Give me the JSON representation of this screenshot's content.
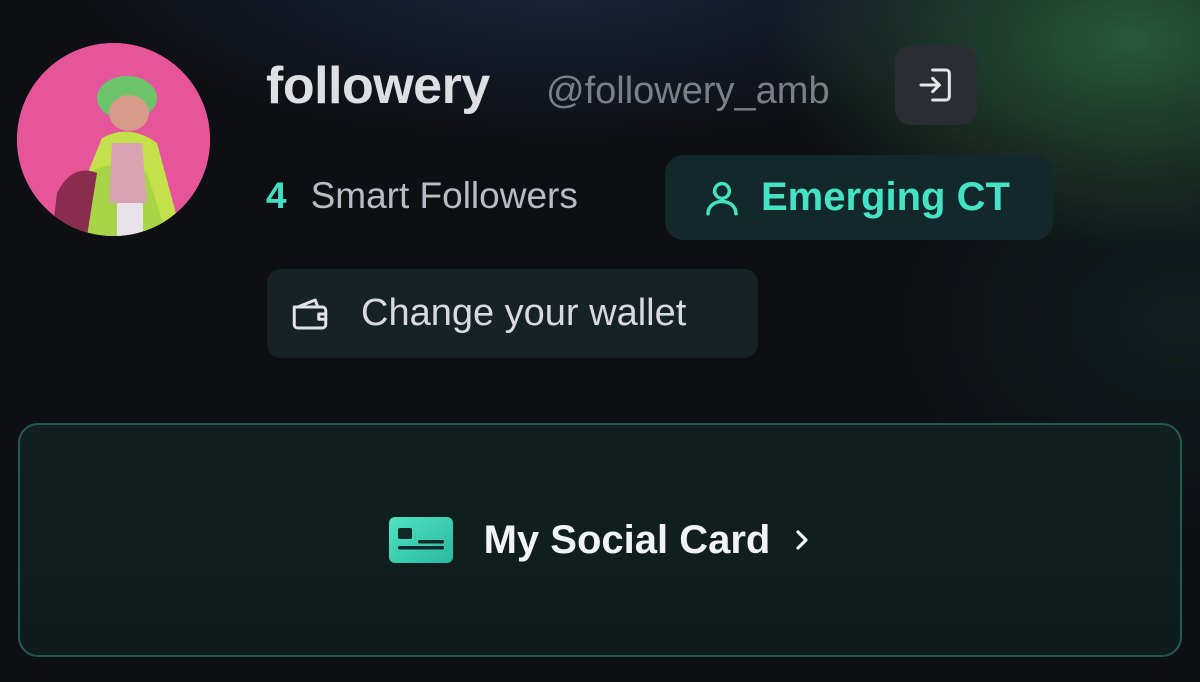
{
  "profile": {
    "display_name": "followery",
    "handle": "@followery_amb",
    "smart_followers_count": "4",
    "smart_followers_label": "Smart Followers",
    "tier_label": "Emerging CT"
  },
  "actions": {
    "change_wallet_label": "Change your wallet",
    "social_card_label": "My Social Card"
  },
  "icons": {
    "logout": "logout-icon",
    "tier": "user-icon",
    "wallet": "wallet-icon",
    "social_card": "id-card-icon",
    "chevron": "chevron-right-icon"
  },
  "colors": {
    "accent": "#44e3c6",
    "background": "#0e0f13",
    "card_border": "#24594f"
  }
}
